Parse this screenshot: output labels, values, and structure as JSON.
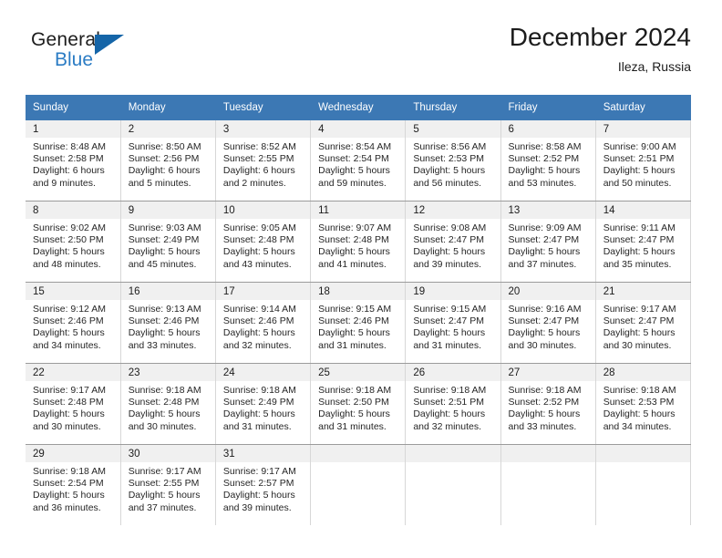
{
  "brand": {
    "name_top": "General",
    "name_bottom": "Blue",
    "triangle_color": "#1565a8",
    "blue_color": "#2b7cc4"
  },
  "header": {
    "title": "December 2024",
    "location": "Ileza, Russia",
    "header_bg": "#3c78b4"
  },
  "weekdays": [
    "Sunday",
    "Monday",
    "Tuesday",
    "Wednesday",
    "Thursday",
    "Friday",
    "Saturday"
  ],
  "weeks": [
    [
      {
        "day": "1",
        "sunrise": "Sunrise: 8:48 AM",
        "sunset": "Sunset: 2:58 PM",
        "daylight1": "Daylight: 6 hours",
        "daylight2": "and 9 minutes."
      },
      {
        "day": "2",
        "sunrise": "Sunrise: 8:50 AM",
        "sunset": "Sunset: 2:56 PM",
        "daylight1": "Daylight: 6 hours",
        "daylight2": "and 5 minutes."
      },
      {
        "day": "3",
        "sunrise": "Sunrise: 8:52 AM",
        "sunset": "Sunset: 2:55 PM",
        "daylight1": "Daylight: 6 hours",
        "daylight2": "and 2 minutes."
      },
      {
        "day": "4",
        "sunrise": "Sunrise: 8:54 AM",
        "sunset": "Sunset: 2:54 PM",
        "daylight1": "Daylight: 5 hours",
        "daylight2": "and 59 minutes."
      },
      {
        "day": "5",
        "sunrise": "Sunrise: 8:56 AM",
        "sunset": "Sunset: 2:53 PM",
        "daylight1": "Daylight: 5 hours",
        "daylight2": "and 56 minutes."
      },
      {
        "day": "6",
        "sunrise": "Sunrise: 8:58 AM",
        "sunset": "Sunset: 2:52 PM",
        "daylight1": "Daylight: 5 hours",
        "daylight2": "and 53 minutes."
      },
      {
        "day": "7",
        "sunrise": "Sunrise: 9:00 AM",
        "sunset": "Sunset: 2:51 PM",
        "daylight1": "Daylight: 5 hours",
        "daylight2": "and 50 minutes."
      }
    ],
    [
      {
        "day": "8",
        "sunrise": "Sunrise: 9:02 AM",
        "sunset": "Sunset: 2:50 PM",
        "daylight1": "Daylight: 5 hours",
        "daylight2": "and 48 minutes."
      },
      {
        "day": "9",
        "sunrise": "Sunrise: 9:03 AM",
        "sunset": "Sunset: 2:49 PM",
        "daylight1": "Daylight: 5 hours",
        "daylight2": "and 45 minutes."
      },
      {
        "day": "10",
        "sunrise": "Sunrise: 9:05 AM",
        "sunset": "Sunset: 2:48 PM",
        "daylight1": "Daylight: 5 hours",
        "daylight2": "and 43 minutes."
      },
      {
        "day": "11",
        "sunrise": "Sunrise: 9:07 AM",
        "sunset": "Sunset: 2:48 PM",
        "daylight1": "Daylight: 5 hours",
        "daylight2": "and 41 minutes."
      },
      {
        "day": "12",
        "sunrise": "Sunrise: 9:08 AM",
        "sunset": "Sunset: 2:47 PM",
        "daylight1": "Daylight: 5 hours",
        "daylight2": "and 39 minutes."
      },
      {
        "day": "13",
        "sunrise": "Sunrise: 9:09 AM",
        "sunset": "Sunset: 2:47 PM",
        "daylight1": "Daylight: 5 hours",
        "daylight2": "and 37 minutes."
      },
      {
        "day": "14",
        "sunrise": "Sunrise: 9:11 AM",
        "sunset": "Sunset: 2:47 PM",
        "daylight1": "Daylight: 5 hours",
        "daylight2": "and 35 minutes."
      }
    ],
    [
      {
        "day": "15",
        "sunrise": "Sunrise: 9:12 AM",
        "sunset": "Sunset: 2:46 PM",
        "daylight1": "Daylight: 5 hours",
        "daylight2": "and 34 minutes."
      },
      {
        "day": "16",
        "sunrise": "Sunrise: 9:13 AM",
        "sunset": "Sunset: 2:46 PM",
        "daylight1": "Daylight: 5 hours",
        "daylight2": "and 33 minutes."
      },
      {
        "day": "17",
        "sunrise": "Sunrise: 9:14 AM",
        "sunset": "Sunset: 2:46 PM",
        "daylight1": "Daylight: 5 hours",
        "daylight2": "and 32 minutes."
      },
      {
        "day": "18",
        "sunrise": "Sunrise: 9:15 AM",
        "sunset": "Sunset: 2:46 PM",
        "daylight1": "Daylight: 5 hours",
        "daylight2": "and 31 minutes."
      },
      {
        "day": "19",
        "sunrise": "Sunrise: 9:15 AM",
        "sunset": "Sunset: 2:47 PM",
        "daylight1": "Daylight: 5 hours",
        "daylight2": "and 31 minutes."
      },
      {
        "day": "20",
        "sunrise": "Sunrise: 9:16 AM",
        "sunset": "Sunset: 2:47 PM",
        "daylight1": "Daylight: 5 hours",
        "daylight2": "and 30 minutes."
      },
      {
        "day": "21",
        "sunrise": "Sunrise: 9:17 AM",
        "sunset": "Sunset: 2:47 PM",
        "daylight1": "Daylight: 5 hours",
        "daylight2": "and 30 minutes."
      }
    ],
    [
      {
        "day": "22",
        "sunrise": "Sunrise: 9:17 AM",
        "sunset": "Sunset: 2:48 PM",
        "daylight1": "Daylight: 5 hours",
        "daylight2": "and 30 minutes."
      },
      {
        "day": "23",
        "sunrise": "Sunrise: 9:18 AM",
        "sunset": "Sunset: 2:48 PM",
        "daylight1": "Daylight: 5 hours",
        "daylight2": "and 30 minutes."
      },
      {
        "day": "24",
        "sunrise": "Sunrise: 9:18 AM",
        "sunset": "Sunset: 2:49 PM",
        "daylight1": "Daylight: 5 hours",
        "daylight2": "and 31 minutes."
      },
      {
        "day": "25",
        "sunrise": "Sunrise: 9:18 AM",
        "sunset": "Sunset: 2:50 PM",
        "daylight1": "Daylight: 5 hours",
        "daylight2": "and 31 minutes."
      },
      {
        "day": "26",
        "sunrise": "Sunrise: 9:18 AM",
        "sunset": "Sunset: 2:51 PM",
        "daylight1": "Daylight: 5 hours",
        "daylight2": "and 32 minutes."
      },
      {
        "day": "27",
        "sunrise": "Sunrise: 9:18 AM",
        "sunset": "Sunset: 2:52 PM",
        "daylight1": "Daylight: 5 hours",
        "daylight2": "and 33 minutes."
      },
      {
        "day": "28",
        "sunrise": "Sunrise: 9:18 AM",
        "sunset": "Sunset: 2:53 PM",
        "daylight1": "Daylight: 5 hours",
        "daylight2": "and 34 minutes."
      }
    ],
    [
      {
        "day": "29",
        "sunrise": "Sunrise: 9:18 AM",
        "sunset": "Sunset: 2:54 PM",
        "daylight1": "Daylight: 5 hours",
        "daylight2": "and 36 minutes."
      },
      {
        "day": "30",
        "sunrise": "Sunrise: 9:17 AM",
        "sunset": "Sunset: 2:55 PM",
        "daylight1": "Daylight: 5 hours",
        "daylight2": "and 37 minutes."
      },
      {
        "day": "31",
        "sunrise": "Sunrise: 9:17 AM",
        "sunset": "Sunset: 2:57 PM",
        "daylight1": "Daylight: 5 hours",
        "daylight2": "and 39 minutes."
      },
      {
        "day": "",
        "sunrise": "",
        "sunset": "",
        "daylight1": "",
        "daylight2": ""
      },
      {
        "day": "",
        "sunrise": "",
        "sunset": "",
        "daylight1": "",
        "daylight2": ""
      },
      {
        "day": "",
        "sunrise": "",
        "sunset": "",
        "daylight1": "",
        "daylight2": ""
      },
      {
        "day": "",
        "sunrise": "",
        "sunset": "",
        "daylight1": "",
        "daylight2": ""
      }
    ]
  ]
}
